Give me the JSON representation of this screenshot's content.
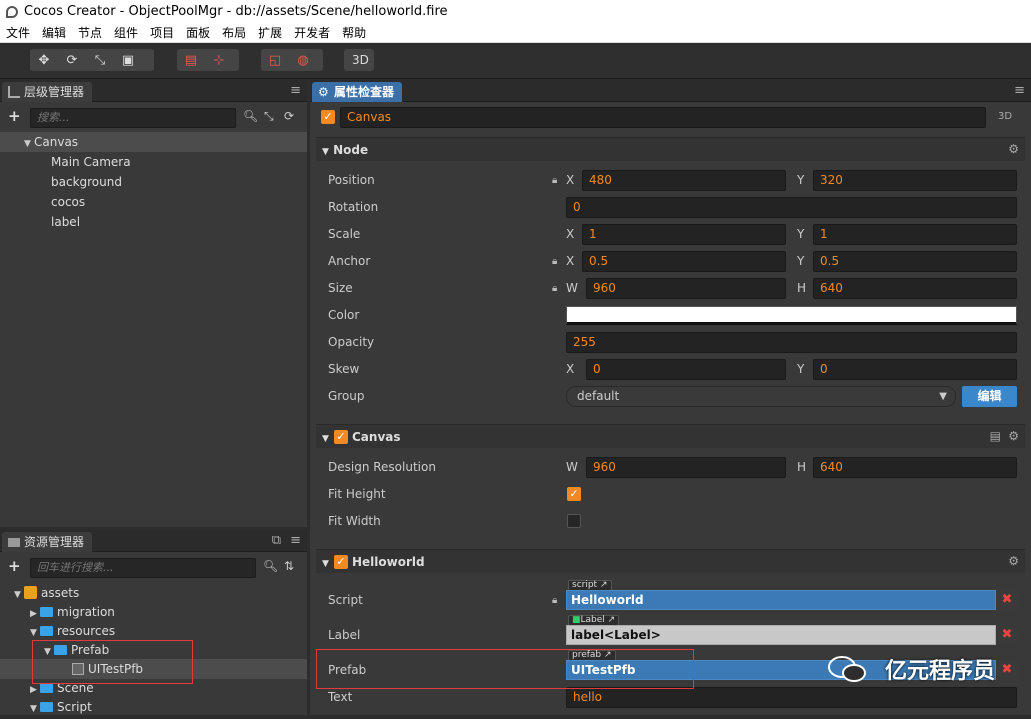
{
  "window": {
    "title": "Cocos Creator - ObjectPoolMgr - db://assets/Scene/helloworld.fire"
  },
  "menu": [
    "文件",
    "编辑",
    "节点",
    "组件",
    "项目",
    "面板",
    "布局",
    "扩展",
    "开发者",
    "帮助"
  ],
  "toolbar": {
    "mode_3d": "3D"
  },
  "hierarchy": {
    "tab": "层级管理器",
    "search_placeholder": "搜索...",
    "root": "Canvas",
    "children": [
      "Main Camera",
      "background",
      "cocos",
      "label"
    ]
  },
  "assets": {
    "tab": "资源管理器",
    "search_placeholder": "回车进行搜索...",
    "items": [
      {
        "label": "assets",
        "level": 0
      },
      {
        "label": "migration",
        "level": 1
      },
      {
        "label": "resources",
        "level": 1
      },
      {
        "label": "Prefab",
        "level": 2
      },
      {
        "label": "UITestPfb",
        "level": 3
      },
      {
        "label": "Scene",
        "level": 1
      },
      {
        "label": "Script",
        "level": 1
      }
    ]
  },
  "inspector": {
    "tab": "属性检查器",
    "node_name": "Canvas",
    "node_3d": "3D",
    "node_section": "Node",
    "position": {
      "label": "Position",
      "x": "480",
      "y": "320"
    },
    "rotation": {
      "label": "Rotation",
      "value": "0"
    },
    "scale": {
      "label": "Scale",
      "x": "1",
      "y": "1"
    },
    "anchor": {
      "label": "Anchor",
      "x": "0.5",
      "y": "0.5"
    },
    "size": {
      "label": "Size",
      "w": "960",
      "h": "640"
    },
    "color": {
      "label": "Color",
      "value": "#ffffff"
    },
    "opacity": {
      "label": "Opacity",
      "value": "255"
    },
    "skew": {
      "label": "Skew",
      "x": "0",
      "y": "0"
    },
    "group": {
      "label": "Group",
      "value": "default",
      "edit": "编辑"
    },
    "canvas_section": "Canvas",
    "design_res": {
      "label": "Design Resolution",
      "w": "960",
      "h": "640"
    },
    "fit_height": {
      "label": "Fit Height",
      "checked": true
    },
    "fit_width": {
      "label": "Fit Width",
      "checked": false
    },
    "hw_section": "Helloworld",
    "script": {
      "label": "Script",
      "tag": "script",
      "value": "Helloworld"
    },
    "labelprop": {
      "label": "Label",
      "tag": "Label",
      "value": "label<Label>"
    },
    "prefab": {
      "label": "Prefab",
      "tag": "prefab",
      "value": "UITestPfb"
    },
    "text": {
      "label": "Text",
      "value": "hello"
    }
  },
  "axes": {
    "x": "X",
    "y": "Y",
    "w": "W",
    "h": "H"
  },
  "watermark": "亿元程序员"
}
